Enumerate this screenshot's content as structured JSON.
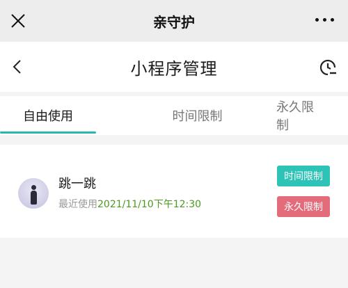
{
  "window": {
    "title": "亲守护"
  },
  "navbar": {
    "title": "小程序管理"
  },
  "tabs": [
    {
      "label": "自由使用",
      "active": true
    },
    {
      "label": "时间限制",
      "active": false
    },
    {
      "label": "永久限制",
      "active": false
    }
  ],
  "app_item": {
    "name": "跳一跳",
    "last_used_label": "最近使用",
    "last_used_time": "2021/11/10下午12:30",
    "time_limit_button": "时间限制",
    "permanent_limit_button": "永久限制"
  },
  "colors": {
    "accent": "#27b8ad",
    "time_button": "#2ec3b7",
    "permanent_button": "#e36b7a",
    "timestamp": "#4a9a1f"
  }
}
